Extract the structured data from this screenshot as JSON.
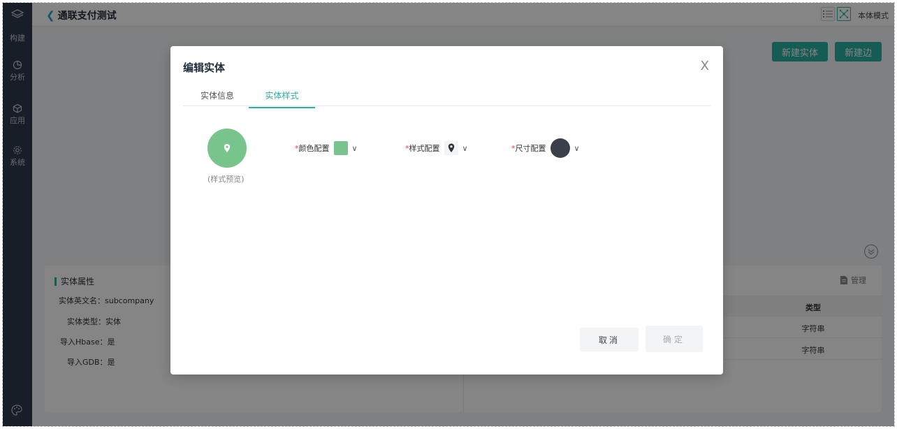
{
  "sidebar": {
    "items": [
      {
        "label": "构建",
        "icon": "layers-icon"
      },
      {
        "label": "分析",
        "icon": "pie-chart-icon"
      },
      {
        "label": "应用",
        "icon": "cube-icon"
      },
      {
        "label": "系统",
        "icon": "gear-icon"
      }
    ],
    "bottom_icon": "palette-icon"
  },
  "header": {
    "title": "通联支付测试",
    "mode_label": "本体模式"
  },
  "actions": {
    "new_entity": "新建实体",
    "new_edge": "新建边"
  },
  "panel": {
    "title": "实体属性",
    "attrs": [
      {
        "key": "实体英文名：",
        "value": "subcompany"
      },
      {
        "key": "实体类型：",
        "value": "实体"
      },
      {
        "key": "导入Hbase：",
        "value": "是"
      },
      {
        "key": "导入GDB：",
        "value": "是"
      }
    ],
    "manage": "管理",
    "table": {
      "header": "类型",
      "rows": [
        "字符串",
        "字符串"
      ]
    }
  },
  "modal": {
    "title": "编辑实体",
    "close": "X",
    "tabs": [
      "实体信息",
      "实体样式"
    ],
    "active_tab": "实体样式",
    "preview_label": "(样式预览)",
    "color_label": "颜色配置",
    "style_label": "样式配置",
    "size_label": "尺寸配置",
    "required_mark": "*",
    "caret": "∨",
    "cancel": "取消",
    "ok": "确定"
  },
  "colors": {
    "accent": "#2ab0a3",
    "preview_green": "#79c48c",
    "sidebar_bg": "#2f3b4c"
  }
}
